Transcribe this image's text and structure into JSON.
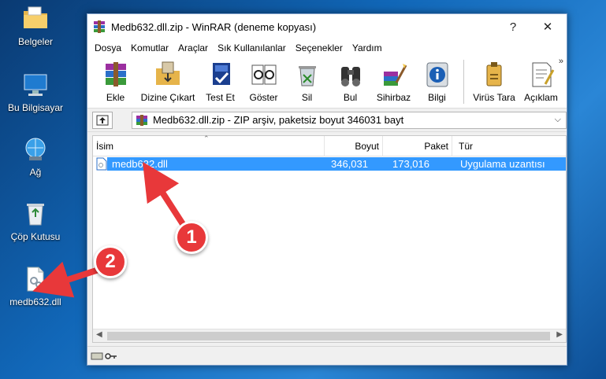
{
  "desktop": {
    "icons": [
      {
        "label": "Belgeler"
      },
      {
        "label": "Bu Bilgisayar"
      },
      {
        "label": "Ağ"
      },
      {
        "label": "Çöp Kutusu"
      },
      {
        "label": "medb632.dll"
      }
    ]
  },
  "window": {
    "title": "Medb632.dll.zip - WinRAR (deneme kopyası)",
    "help_glyph": "?",
    "close_glyph": "✕",
    "menu": [
      "Dosya",
      "Komutlar",
      "Araçlar",
      "Sık Kullanılanlar",
      "Seçenekler",
      "Yardım"
    ],
    "toolbar": [
      {
        "label": "Ekle",
        "icon": "add-archive-icon"
      },
      {
        "label": "Dizine Çıkart",
        "icon": "extract-icon"
      },
      {
        "label": "Test Et",
        "icon": "test-icon"
      },
      {
        "label": "Göster",
        "icon": "view-icon"
      },
      {
        "label": "Sil",
        "icon": "delete-icon"
      },
      {
        "label": "Bul",
        "icon": "find-icon"
      },
      {
        "label": "Sihirbaz",
        "icon": "wizard-icon"
      },
      {
        "label": "Bilgi",
        "icon": "info-icon"
      },
      {
        "label": "Virüs Tara",
        "icon": "virus-scan-icon"
      },
      {
        "label": "Açıklam",
        "icon": "comment-icon"
      }
    ],
    "toolbar_more": "»",
    "address": "Medb632.dll.zip - ZIP arşiv, paketsiz boyut 346031 bayt",
    "columns": [
      "İsim",
      "Boyut",
      "Paket",
      "Tür"
    ],
    "rows": [
      {
        "name": "medb632.dll",
        "size": "346,031",
        "packed": "173,016",
        "type": "Uygulama uzantısı"
      }
    ]
  },
  "annotations": {
    "arrow1": "1",
    "arrow2": "2"
  },
  "colors": {
    "selection": "#3399ff",
    "badge": "#e8383a",
    "arrow": "#e8383a"
  }
}
